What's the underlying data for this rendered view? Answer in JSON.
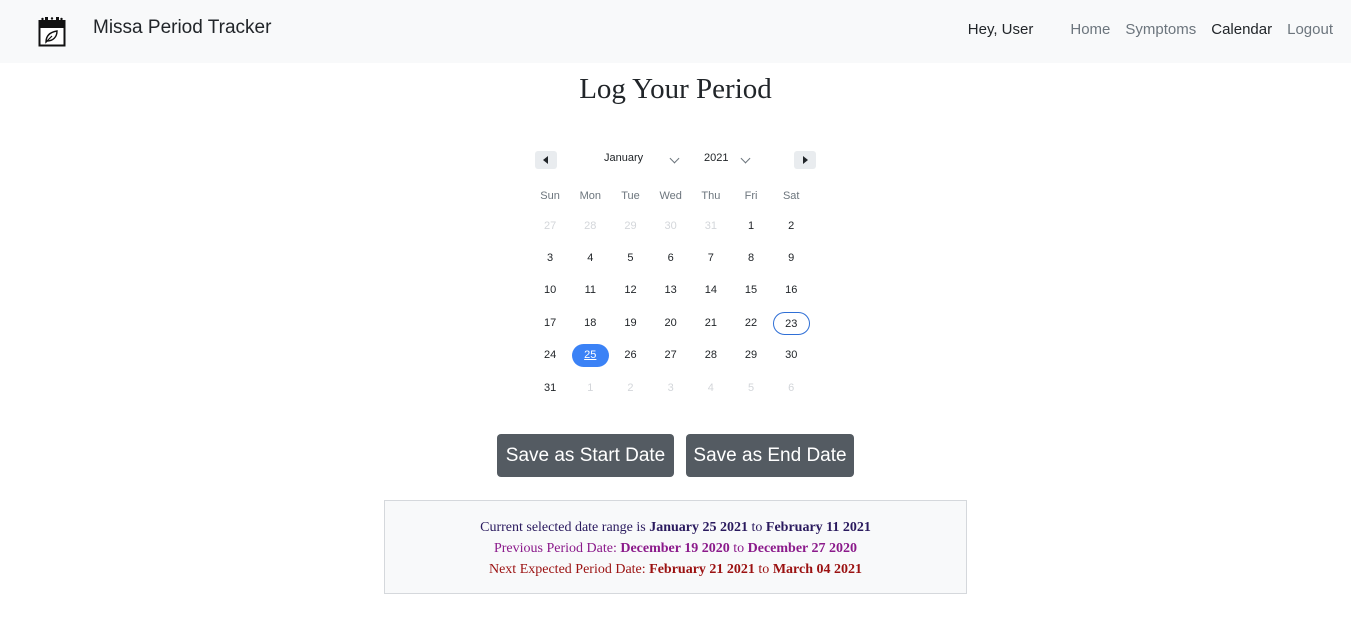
{
  "navbar": {
    "brand": "Missa Period Tracker",
    "greeting": "Hey, User",
    "links": [
      "Home",
      "Symptoms",
      "Calendar",
      "Logout"
    ],
    "active": "Calendar",
    "logo_icon": "calendar-leaf-icon"
  },
  "page": {
    "title": "Log Your Period"
  },
  "calendar": {
    "month": "January",
    "year": "2021",
    "weekdays": [
      "Sun",
      "Mon",
      "Tue",
      "Wed",
      "Thu",
      "Fri",
      "Sat"
    ],
    "weeks": [
      [
        {
          "d": "27",
          "muted": true
        },
        {
          "d": "28",
          "muted": true
        },
        {
          "d": "29",
          "muted": true
        },
        {
          "d": "30",
          "muted": true
        },
        {
          "d": "31",
          "muted": true
        },
        {
          "d": "1"
        },
        {
          "d": "2"
        }
      ],
      [
        {
          "d": "3"
        },
        {
          "d": "4"
        },
        {
          "d": "5"
        },
        {
          "d": "6"
        },
        {
          "d": "7"
        },
        {
          "d": "8"
        },
        {
          "d": "9"
        }
      ],
      [
        {
          "d": "10"
        },
        {
          "d": "11"
        },
        {
          "d": "12"
        },
        {
          "d": "13"
        },
        {
          "d": "14"
        },
        {
          "d": "15"
        },
        {
          "d": "16"
        }
      ],
      [
        {
          "d": "17"
        },
        {
          "d": "18"
        },
        {
          "d": "19"
        },
        {
          "d": "20"
        },
        {
          "d": "21"
        },
        {
          "d": "22"
        },
        {
          "d": "23",
          "today": true
        }
      ],
      [
        {
          "d": "24"
        },
        {
          "d": "25",
          "selected": true
        },
        {
          "d": "26"
        },
        {
          "d": "27"
        },
        {
          "d": "28"
        },
        {
          "d": "29"
        },
        {
          "d": "30"
        }
      ],
      [
        {
          "d": "31"
        },
        {
          "d": "1",
          "muted": true
        },
        {
          "d": "2",
          "muted": true
        },
        {
          "d": "3",
          "muted": true
        },
        {
          "d": "4",
          "muted": true
        },
        {
          "d": "5",
          "muted": true
        },
        {
          "d": "6",
          "muted": true
        }
      ]
    ],
    "selected_color": "#3b82f6",
    "today_border_color": "#2f6fd6"
  },
  "buttons": {
    "start": "Save as Start Date",
    "end": "Save as End Date"
  },
  "info": {
    "current": {
      "prefix": "Current selected date range is",
      "from": "January 25 2021",
      "sep": "to",
      "to": "February 11 2021",
      "color": "#2a1a5e"
    },
    "previous": {
      "prefix": "Previous Period Date:",
      "from": "December 19 2020",
      "sep": "to",
      "to": "December 27 2020",
      "color": "#8b1a8b"
    },
    "next": {
      "prefix": "Next Expected Period Date:",
      "from": "February 21 2021",
      "sep": "to",
      "to": "March 04 2021",
      "color": "#9b1111"
    }
  }
}
